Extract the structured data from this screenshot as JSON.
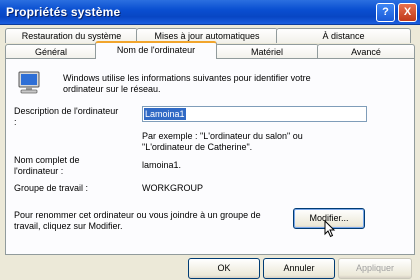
{
  "window": {
    "title": "Propriétés système",
    "help_label": "?",
    "close_label": "X"
  },
  "tabs": {
    "row1": [
      "Restauration du système",
      "Mises à jour automatiques",
      "À distance"
    ],
    "row2": [
      "Général",
      "Nom de l'ordinateur",
      "Matériel",
      "Avancé"
    ],
    "active": "Nom de l'ordinateur"
  },
  "panel": {
    "intro": "Windows utilise les informations suivantes pour identifier votre ordinateur sur le réseau.",
    "description_label": "Description de l'ordinateur :",
    "description_value": "Lamoina1",
    "example_text": "Par exemple : \"L'ordinateur du salon\" ou \"L'ordinateur de Catherine\".",
    "fullname_label": "Nom complet de l'ordinateur :",
    "fullname_value": "lamoina1.",
    "workgroup_label": "Groupe de travail :",
    "workgroup_value": "WORKGROUP",
    "rename_text": "Pour renommer cet ordinateur ou vous joindre à un groupe de travail, cliquez sur Modifier.",
    "modify_label": "Modifier..."
  },
  "footer": {
    "ok_label": "OK",
    "cancel_label": "Annuler",
    "apply_label": "Appliquer"
  },
  "colors": {
    "titlebar": "#0a4fd1",
    "active_tab_accent": "#f1a52d",
    "selection": "#316ac5"
  }
}
